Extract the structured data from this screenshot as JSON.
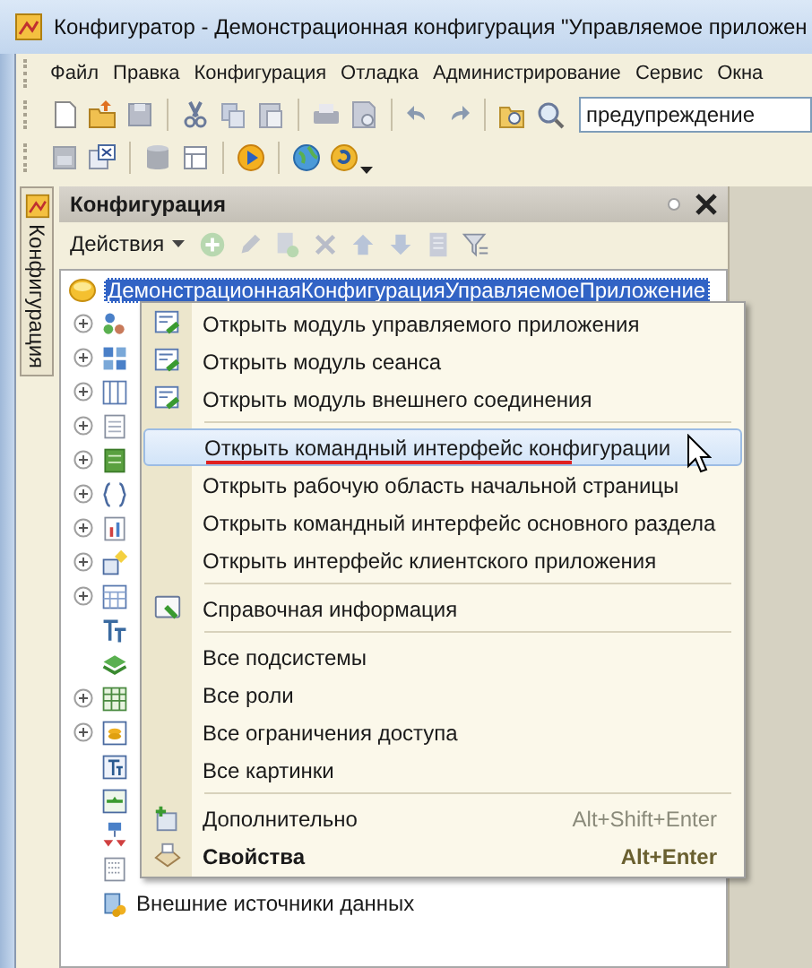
{
  "window": {
    "title": "Конфигуратор - Демонстрационная конфигурация \"Управляемое приложен"
  },
  "menu_bar": [
    "Файл",
    "Правка",
    "Конфигурация",
    "Отладка",
    "Администрирование",
    "Сервис",
    "Окна"
  ],
  "search": {
    "value": "предупреждение"
  },
  "side_tab": "Конфигурация",
  "panel": {
    "title": "Конфигурация",
    "actions_label": "Действия"
  },
  "tree": {
    "label": "ДемонстрационнаяКонфигурацияУправляемоеПриложение",
    "selected": true,
    "children": [
      {
        "expandable": true
      },
      {
        "expandable": true
      },
      {
        "expandable": true
      },
      {
        "expandable": true
      },
      {
        "expandable": true
      },
      {
        "expandable": true
      },
      {
        "expandable": true
      },
      {
        "expandable": true
      },
      {
        "expandable": true
      },
      {
        "expandable": false
      },
      {
        "expandable": false
      },
      {
        "expandable": true
      },
      {
        "expandable": true
      },
      {
        "expandable": false
      },
      {
        "expandable": false
      },
      {
        "expandable": false
      },
      {
        "expandable": false
      },
      {
        "label": "Внешние источники данных",
        "expandable": false
      }
    ]
  },
  "context_menu": [
    {
      "kind": "item",
      "label": "Открыть модуль управляемого приложения",
      "has_icon": true,
      "selected": false,
      "bold": false,
      "underlined": false
    },
    {
      "kind": "item",
      "label": "Открыть модуль сеанса",
      "has_icon": true,
      "selected": false,
      "bold": false,
      "underlined": false
    },
    {
      "kind": "item",
      "label": "Открыть модуль внешнего соединения",
      "has_icon": true,
      "selected": false,
      "bold": false,
      "underlined": false
    },
    {
      "kind": "separator"
    },
    {
      "kind": "item",
      "label": "Открыть командный интерфейс конфигурации",
      "has_icon": false,
      "selected": true,
      "bold": false,
      "underlined": true
    },
    {
      "kind": "item",
      "label": "Открыть рабочую область начальной страницы",
      "has_icon": false,
      "selected": false,
      "bold": false,
      "underlined": false
    },
    {
      "kind": "item",
      "label": "Открыть командный интерфейс основного раздела",
      "has_icon": false,
      "selected": false,
      "bold": false,
      "underlined": false
    },
    {
      "kind": "item",
      "label": "Открыть интерфейс клиентского приложения",
      "has_icon": false,
      "selected": false,
      "bold": false,
      "underlined": false
    },
    {
      "kind": "separator"
    },
    {
      "kind": "item",
      "label": "Справочная информация",
      "has_icon": true,
      "selected": false,
      "bold": false,
      "underlined": false
    },
    {
      "kind": "separator"
    },
    {
      "kind": "item",
      "label": "Все подсистемы",
      "has_icon": false,
      "selected": false,
      "bold": false,
      "underlined": false
    },
    {
      "kind": "item",
      "label": "Все роли",
      "has_icon": false,
      "selected": false,
      "bold": false,
      "underlined": false
    },
    {
      "kind": "item",
      "label": "Все ограничения доступа",
      "has_icon": false,
      "selected": false,
      "bold": false,
      "underlined": false
    },
    {
      "kind": "item",
      "label": "Все картинки",
      "has_icon": false,
      "selected": false,
      "bold": false,
      "underlined": false
    },
    {
      "kind": "separator"
    },
    {
      "kind": "item",
      "label": "Дополнительно",
      "shortcut": "Alt+Shift+Enter",
      "has_icon": true,
      "selected": false,
      "bold": false,
      "underlined": false
    },
    {
      "kind": "item",
      "label": "Свойства",
      "shortcut": "Alt+Enter",
      "has_icon": true,
      "selected": false,
      "bold": true,
      "underlined": false
    }
  ]
}
